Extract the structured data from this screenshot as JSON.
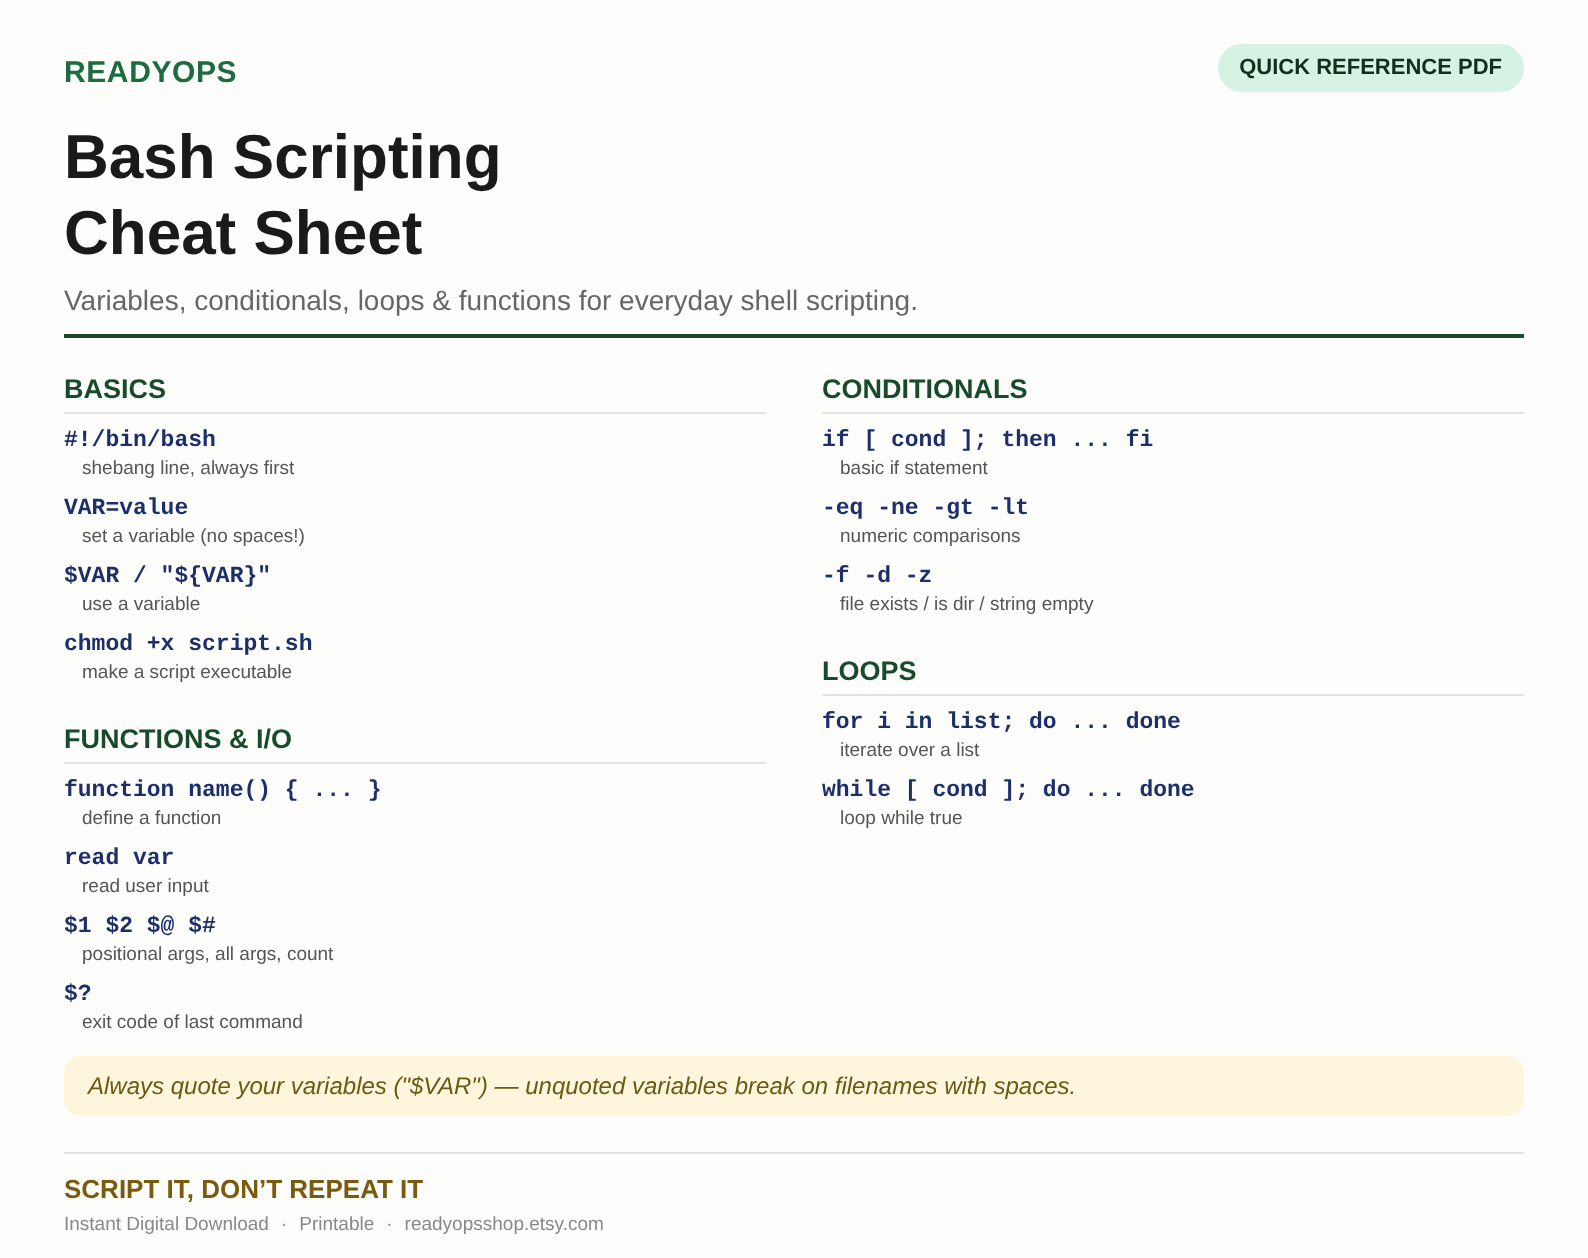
{
  "brand": "READYOPS",
  "badge": "QUICK REFERENCE PDF",
  "title_lines": [
    "Bash Scripting",
    "Cheat Sheet"
  ],
  "subtitle": "Variables, conditionals, loops & functions for everyday shell scripting.",
  "columns": [
    [
      {
        "heading": "BASICS",
        "items": [
          {
            "code": "#!/bin/bash",
            "desc": "shebang line, always first"
          },
          {
            "code": "VAR=value",
            "desc": "set a variable (no spaces!)"
          },
          {
            "code": "$VAR / \"${VAR}\"",
            "desc": "use a variable"
          },
          {
            "code": "chmod +x script.sh",
            "desc": "make a script executable"
          }
        ]
      },
      {
        "heading": "FUNCTIONS & I/O",
        "items": [
          {
            "code": "function name() { ... }",
            "desc": "define a function"
          },
          {
            "code": "read var",
            "desc": "read user input"
          },
          {
            "code": "$1 $2 $@ $#",
            "desc": "positional args, all args, count"
          },
          {
            "code": "$?",
            "desc": "exit code of last command"
          }
        ]
      }
    ],
    [
      {
        "heading": "CONDITIONALS",
        "items": [
          {
            "code": "if [ cond ]; then ... fi",
            "desc": "basic if statement"
          },
          {
            "code": "-eq -ne -gt -lt",
            "desc": "numeric comparisons"
          },
          {
            "code": "-f -d -z",
            "desc": "file exists / is dir / string empty"
          }
        ]
      },
      {
        "heading": "LOOPS",
        "items": [
          {
            "code": "for i in list; do ... done",
            "desc": "iterate over a list"
          },
          {
            "code": "while [ cond ]; do ... done",
            "desc": "loop while true"
          }
        ]
      }
    ]
  ],
  "tip": "Always quote your variables (\"$VAR\") — unquoted variables break on filenames with spaces.",
  "footer": {
    "tagline": "SCRIPT IT, DON’T REPEAT IT",
    "separator": "·",
    "meta": [
      "Instant Digital Download",
      "Printable",
      "readyopsshop.etsy.com"
    ]
  }
}
